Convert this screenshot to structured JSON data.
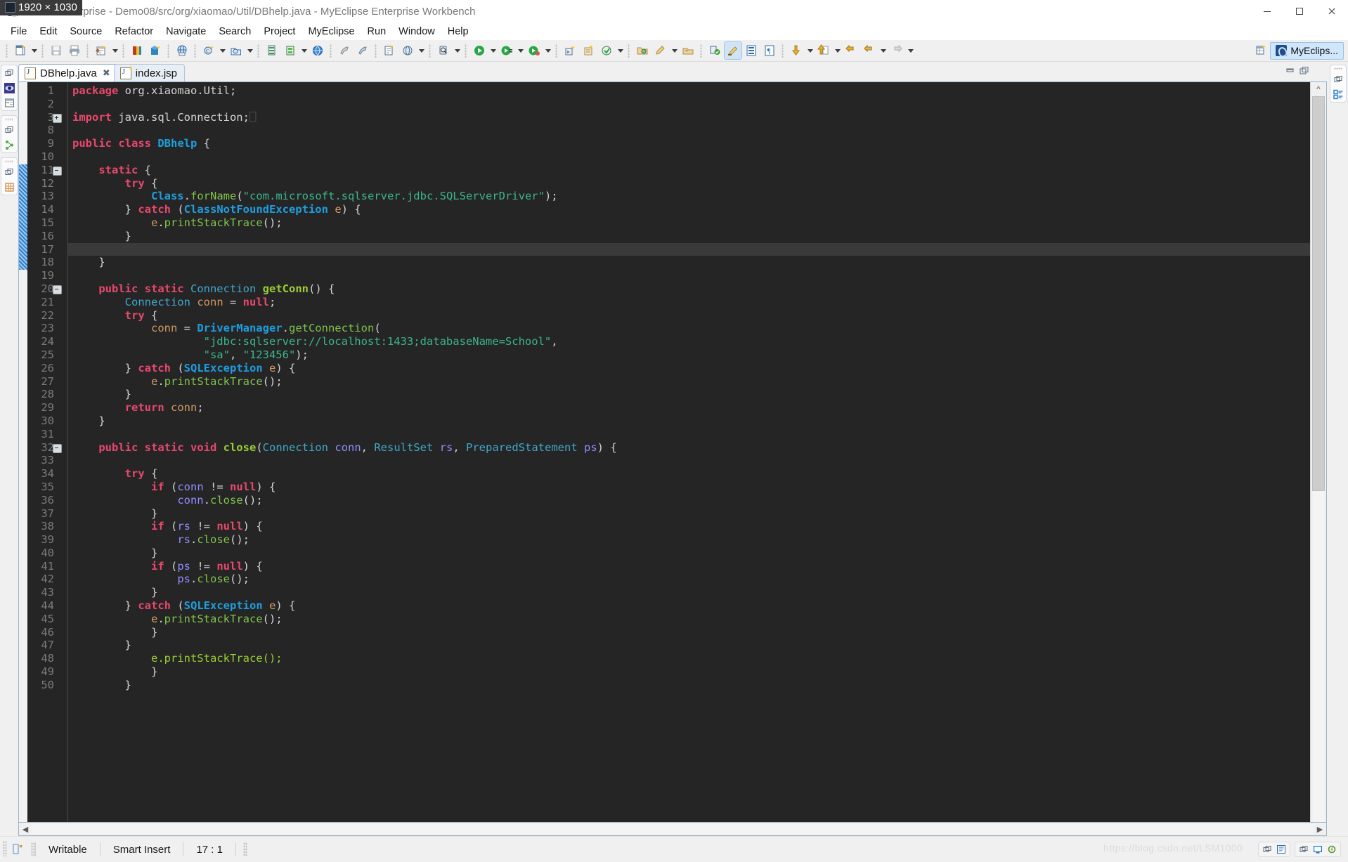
{
  "window": {
    "title": "e Java Enterprise - Demo08/src/org/xiaomao/Util/DBhelp.java - MyEclipse Enterprise Workbench",
    "size_badge": "1920 × 1030",
    "minimize_label": "Minimize",
    "maximize_label": "Maximize",
    "close_label": "Close"
  },
  "menubar": {
    "items": [
      {
        "label": "File"
      },
      {
        "label": "Edit"
      },
      {
        "label": "Source"
      },
      {
        "label": "Refactor"
      },
      {
        "label": "Navigate"
      },
      {
        "label": "Search"
      },
      {
        "label": "Project"
      },
      {
        "label": "MyEclipse"
      },
      {
        "label": "Run"
      },
      {
        "label": "Window"
      },
      {
        "label": "Help"
      }
    ]
  },
  "toolbar": {
    "perspective_label": "MyEclips...",
    "icons": [
      "new-wizard-icon",
      "save-icon",
      "print-icon",
      "new-project-icon",
      "deploy-icon",
      "deploy-all-icon",
      "browser-icon",
      "new-class-icon",
      "new-package-icon",
      "db-explorer-icon",
      "db-browser-icon",
      "globe-icon",
      "run-last-icon",
      "debug-last-icon",
      "new-server-icon",
      "open-web-icon",
      "search-icon",
      "run-icon",
      "debug-icon",
      "profile-icon",
      "run-as-icon",
      "coverage-icon",
      "external-tools-icon",
      "open-type-icon",
      "pencil-icon",
      "open-task-icon",
      "toggle-mark-icon",
      "highlight-icon",
      "block-selection-icon",
      "whitespace-icon",
      "next-annotation-icon",
      "prev-annotation-icon",
      "last-edit-icon",
      "back-icon",
      "forward-icon"
    ]
  },
  "tabs": [
    {
      "label": "DBhelp.java",
      "icon": "java-file-icon",
      "active": true,
      "closeable": true
    },
    {
      "label": "index.jsp",
      "icon": "jsp-file-icon",
      "active": false,
      "closeable": false
    }
  ],
  "editor": {
    "current_line": 17,
    "lines": [
      {
        "n": "1",
        "fold": "",
        "cur": false,
        "tokens": [
          {
            "t": "package ",
            "c": "k"
          },
          {
            "t": "org.xiaomao.Util;",
            "c": "pl"
          }
        ]
      },
      {
        "n": "2",
        "fold": "",
        "cur": false,
        "tokens": []
      },
      {
        "n": "3",
        "fold": "plus",
        "cur": false,
        "tokens": [
          {
            "t": "import ",
            "c": "k"
          },
          {
            "t": "java.sql.Connection;",
            "c": "pl"
          },
          {
            "t": "⎕",
            "c": "dim"
          }
        ]
      },
      {
        "n": "8",
        "fold": "",
        "cur": false,
        "tokens": []
      },
      {
        "n": "9",
        "fold": "",
        "cur": false,
        "tokens": [
          {
            "t": "public class ",
            "c": "k"
          },
          {
            "t": "DBhelp",
            "c": "tb2"
          },
          {
            "t": " {",
            "c": "pl"
          }
        ]
      },
      {
        "n": "10",
        "fold": "",
        "cur": false,
        "tokens": []
      },
      {
        "n": "11",
        "fold": "minus",
        "cur": false,
        "tokens": [
          {
            "t": "    ",
            "c": "pl"
          },
          {
            "t": "static",
            "c": "k"
          },
          {
            "t": " {",
            "c": "pl"
          }
        ]
      },
      {
        "n": "12",
        "fold": "",
        "cur": false,
        "tokens": [
          {
            "t": "        ",
            "c": "pl"
          },
          {
            "t": "try",
            "c": "k"
          },
          {
            "t": " {",
            "c": "pl"
          }
        ]
      },
      {
        "n": "13",
        "fold": "",
        "cur": false,
        "tokens": [
          {
            "t": "            ",
            "c": "pl"
          },
          {
            "t": "Class",
            "c": "tb2"
          },
          {
            "t": ".",
            "c": "pl"
          },
          {
            "t": "forName",
            "c": "m"
          },
          {
            "t": "(",
            "c": "pl"
          },
          {
            "t": "\"com.microsoft.sqlserver.jdbc.SQLServerDriver\"",
            "c": "s"
          },
          {
            "t": ");",
            "c": "pl"
          }
        ]
      },
      {
        "n": "14",
        "fold": "",
        "cur": false,
        "tokens": [
          {
            "t": "        } ",
            "c": "pl"
          },
          {
            "t": "catch",
            "c": "k"
          },
          {
            "t": " (",
            "c": "pl"
          },
          {
            "t": "ClassNotFoundException",
            "c": "tb2"
          },
          {
            "t": " ",
            "c": "pl"
          },
          {
            "t": "e",
            "c": "v"
          },
          {
            "t": ") {",
            "c": "pl"
          }
        ]
      },
      {
        "n": "15",
        "fold": "",
        "cur": false,
        "tokens": [
          {
            "t": "            ",
            "c": "pl"
          },
          {
            "t": "e",
            "c": "v"
          },
          {
            "t": ".",
            "c": "pl"
          },
          {
            "t": "printStackTrace",
            "c": "m"
          },
          {
            "t": "();",
            "c": "pl"
          }
        ]
      },
      {
        "n": "16",
        "fold": "",
        "cur": false,
        "tokens": [
          {
            "t": "        }",
            "c": "pl"
          }
        ]
      },
      {
        "n": "17",
        "fold": "",
        "cur": true,
        "tokens": []
      },
      {
        "n": "18",
        "fold": "",
        "cur": false,
        "tokens": [
          {
            "t": "    }",
            "c": "pl"
          }
        ]
      },
      {
        "n": "19",
        "fold": "",
        "cur": false,
        "tokens": []
      },
      {
        "n": "20",
        "fold": "minus",
        "cur": false,
        "tokens": [
          {
            "t": "    ",
            "c": "pl"
          },
          {
            "t": "public static ",
            "c": "k"
          },
          {
            "t": "Connection",
            "c": "t"
          },
          {
            "t": " ",
            "c": "pl"
          },
          {
            "t": "getConn",
            "c": "mb"
          },
          {
            "t": "() {",
            "c": "pl"
          }
        ]
      },
      {
        "n": "21",
        "fold": "",
        "cur": false,
        "tokens": [
          {
            "t": "        ",
            "c": "pl"
          },
          {
            "t": "Connection",
            "c": "t"
          },
          {
            "t": " ",
            "c": "pl"
          },
          {
            "t": "conn",
            "c": "v"
          },
          {
            "t": " = ",
            "c": "pl"
          },
          {
            "t": "null",
            "c": "k"
          },
          {
            "t": ";",
            "c": "pl"
          }
        ]
      },
      {
        "n": "22",
        "fold": "",
        "cur": false,
        "tokens": [
          {
            "t": "        ",
            "c": "pl"
          },
          {
            "t": "try",
            "c": "k"
          },
          {
            "t": " {",
            "c": "pl"
          }
        ]
      },
      {
        "n": "23",
        "fold": "",
        "cur": false,
        "tokens": [
          {
            "t": "            ",
            "c": "pl"
          },
          {
            "t": "conn",
            "c": "v"
          },
          {
            "t": " = ",
            "c": "pl"
          },
          {
            "t": "DriverManager",
            "c": "tb2"
          },
          {
            "t": ".",
            "c": "pl"
          },
          {
            "t": "getConnection",
            "c": "m"
          },
          {
            "t": "(",
            "c": "pl"
          }
        ]
      },
      {
        "n": "24",
        "fold": "",
        "cur": false,
        "tokens": [
          {
            "t": "                    ",
            "c": "pl"
          },
          {
            "t": "\"jdbc:sqlserver://localhost:1433;databaseName=School\"",
            "c": "s"
          },
          {
            "t": ",",
            "c": "pl"
          }
        ]
      },
      {
        "n": "25",
        "fold": "",
        "cur": false,
        "tokens": [
          {
            "t": "                    ",
            "c": "pl"
          },
          {
            "t": "\"sa\"",
            "c": "s"
          },
          {
            "t": ", ",
            "c": "pl"
          },
          {
            "t": "\"123456\"",
            "c": "s"
          },
          {
            "t": ");",
            "c": "pl"
          }
        ]
      },
      {
        "n": "26",
        "fold": "",
        "cur": false,
        "tokens": [
          {
            "t": "        } ",
            "c": "pl"
          },
          {
            "t": "catch",
            "c": "k"
          },
          {
            "t": " (",
            "c": "pl"
          },
          {
            "t": "SQLException",
            "c": "tb2"
          },
          {
            "t": " ",
            "c": "pl"
          },
          {
            "t": "e",
            "c": "v"
          },
          {
            "t": ") {",
            "c": "pl"
          }
        ]
      },
      {
        "n": "27",
        "fold": "",
        "cur": false,
        "tokens": [
          {
            "t": "            ",
            "c": "pl"
          },
          {
            "t": "e",
            "c": "v"
          },
          {
            "t": ".",
            "c": "pl"
          },
          {
            "t": "printStackTrace",
            "c": "m"
          },
          {
            "t": "();",
            "c": "pl"
          }
        ]
      },
      {
        "n": "28",
        "fold": "",
        "cur": false,
        "tokens": [
          {
            "t": "        }",
            "c": "pl"
          }
        ]
      },
      {
        "n": "29",
        "fold": "",
        "cur": false,
        "tokens": [
          {
            "t": "        ",
            "c": "pl"
          },
          {
            "t": "return",
            "c": "k"
          },
          {
            "t": " ",
            "c": "pl"
          },
          {
            "t": "conn",
            "c": "v"
          },
          {
            "t": ";",
            "c": "pl"
          }
        ]
      },
      {
        "n": "30",
        "fold": "",
        "cur": false,
        "tokens": [
          {
            "t": "    }",
            "c": "pl"
          }
        ]
      },
      {
        "n": "31",
        "fold": "",
        "cur": false,
        "tokens": []
      },
      {
        "n": "32",
        "fold": "minus",
        "cur": false,
        "tokens": [
          {
            "t": "    ",
            "c": "pl"
          },
          {
            "t": "public static void ",
            "c": "k"
          },
          {
            "t": "close",
            "c": "mb"
          },
          {
            "t": "(",
            "c": "pl"
          },
          {
            "t": "Connection",
            "c": "t"
          },
          {
            "t": " ",
            "c": "pl"
          },
          {
            "t": "conn",
            "c": "p"
          },
          {
            "t": ", ",
            "c": "pl"
          },
          {
            "t": "ResultSet",
            "c": "t"
          },
          {
            "t": " ",
            "c": "pl"
          },
          {
            "t": "rs",
            "c": "p"
          },
          {
            "t": ", ",
            "c": "pl"
          },
          {
            "t": "PreparedStatement",
            "c": "t"
          },
          {
            "t": " ",
            "c": "pl"
          },
          {
            "t": "ps",
            "c": "p"
          },
          {
            "t": ") {",
            "c": "pl"
          }
        ]
      },
      {
        "n": "33",
        "fold": "",
        "cur": false,
        "tokens": []
      },
      {
        "n": "34",
        "fold": "",
        "cur": false,
        "tokens": [
          {
            "t": "        ",
            "c": "pl"
          },
          {
            "t": "try",
            "c": "k"
          },
          {
            "t": " {",
            "c": "pl"
          }
        ]
      },
      {
        "n": "35",
        "fold": "",
        "cur": false,
        "tokens": [
          {
            "t": "            ",
            "c": "pl"
          },
          {
            "t": "if",
            "c": "k"
          },
          {
            "t": " (",
            "c": "pl"
          },
          {
            "t": "conn",
            "c": "p"
          },
          {
            "t": " != ",
            "c": "pl"
          },
          {
            "t": "null",
            "c": "k"
          },
          {
            "t": ") {",
            "c": "pl"
          }
        ]
      },
      {
        "n": "36",
        "fold": "",
        "cur": false,
        "tokens": [
          {
            "t": "                ",
            "c": "pl"
          },
          {
            "t": "conn",
            "c": "p"
          },
          {
            "t": ".",
            "c": "pl"
          },
          {
            "t": "close",
            "c": "m"
          },
          {
            "t": "();",
            "c": "pl"
          }
        ]
      },
      {
        "n": "37",
        "fold": "",
        "cur": false,
        "tokens": [
          {
            "t": "            }",
            "c": "pl"
          }
        ]
      },
      {
        "n": "38",
        "fold": "",
        "cur": false,
        "tokens": [
          {
            "t": "            ",
            "c": "pl"
          },
          {
            "t": "if",
            "c": "k"
          },
          {
            "t": " (",
            "c": "pl"
          },
          {
            "t": "rs",
            "c": "p"
          },
          {
            "t": " != ",
            "c": "pl"
          },
          {
            "t": "null",
            "c": "k"
          },
          {
            "t": ") {",
            "c": "pl"
          }
        ]
      },
      {
        "n": "39",
        "fold": "",
        "cur": false,
        "tokens": [
          {
            "t": "                ",
            "c": "pl"
          },
          {
            "t": "rs",
            "c": "p"
          },
          {
            "t": ".",
            "c": "pl"
          },
          {
            "t": "close",
            "c": "m"
          },
          {
            "t": "();",
            "c": "pl"
          }
        ]
      },
      {
        "n": "40",
        "fold": "",
        "cur": false,
        "tokens": [
          {
            "t": "            }",
            "c": "pl"
          }
        ]
      },
      {
        "n": "41",
        "fold": "",
        "cur": false,
        "tokens": [
          {
            "t": "            ",
            "c": "pl"
          },
          {
            "t": "if",
            "c": "k"
          },
          {
            "t": " (",
            "c": "pl"
          },
          {
            "t": "ps",
            "c": "p"
          },
          {
            "t": " != ",
            "c": "pl"
          },
          {
            "t": "null",
            "c": "k"
          },
          {
            "t": ") {",
            "c": "pl"
          }
        ]
      },
      {
        "n": "42",
        "fold": "",
        "cur": false,
        "tokens": [
          {
            "t": "                ",
            "c": "pl"
          },
          {
            "t": "ps",
            "c": "p"
          },
          {
            "t": ".",
            "c": "pl"
          },
          {
            "t": "close",
            "c": "m"
          },
          {
            "t": "();",
            "c": "pl"
          }
        ]
      },
      {
        "n": "43",
        "fold": "",
        "cur": false,
        "tokens": [
          {
            "t": "            }",
            "c": "pl"
          }
        ]
      },
      {
        "n": "44",
        "fold": "",
        "cur": false,
        "tokens": [
          {
            "t": "        } ",
            "c": "pl"
          },
          {
            "t": "catch",
            "c": "k"
          },
          {
            "t": " (",
            "c": "pl"
          },
          {
            "t": "SQLException",
            "c": "tb2"
          },
          {
            "t": " ",
            "c": "pl"
          },
          {
            "t": "e",
            "c": "v"
          },
          {
            "t": ") {",
            "c": "pl"
          }
        ]
      },
      {
        "n": "45",
        "fold": "",
        "cur": false,
        "tokens": [
          {
            "t": "            ",
            "c": "pl"
          },
          {
            "t": "e",
            "c": "v"
          },
          {
            "t": ".",
            "c": "pl"
          },
          {
            "t": "printStackTrace",
            "c": "m"
          },
          {
            "t": "();",
            "c": "pl"
          }
        ]
      },
      {
        "n": "46",
        "fold": "",
        "cur": false,
        "tokens": [
          {
            "t": "            }",
            "c": "pl"
          }
        ]
      },
      {
        "n": "47",
        "fold": "",
        "cur": false,
        "tokens": [
          {
            "t": "        }",
            "c": "pl"
          }
        ]
      },
      {
        "n": "48",
        "fold": "",
        "cur": false,
        "tokens": [
          {
            "t": "            e.printStackTrace();",
            "c": "clip"
          }
        ]
      },
      {
        "n": "49",
        "fold": "",
        "cur": false,
        "tokens": [
          {
            "t": "            }",
            "c": "pl"
          }
        ]
      },
      {
        "n": "50",
        "fold": "",
        "cur": false,
        "tokens": [
          {
            "t": "        }",
            "c": "pl"
          }
        ]
      }
    ]
  },
  "statusbar": {
    "writable": "Writable",
    "insert_mode": "Smart Insert",
    "position": "17 : 1",
    "watermark": "https://blog.csdn.net/LSM1000"
  },
  "left_views": [
    {
      "name": "package-explorer-icon"
    },
    {
      "name": "outline-icon"
    },
    {
      "name": "hierarchy-icon"
    }
  ],
  "colors": {
    "editor_bg": "#252526",
    "current_line": "#3a3a3a",
    "keyword": "#e8486b",
    "type": "#3fa9c9",
    "string": "#3bb58b",
    "method": "#7fc34a",
    "variable": "#d49a5e",
    "param": "#8e8eff",
    "gutter_text": "#7b7b7b",
    "chrome_bg": "#f0f0f0",
    "accent": "#cfe6fb"
  }
}
